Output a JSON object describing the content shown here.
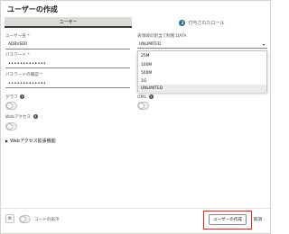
{
  "dialog": {
    "title": "ユーザーの作成"
  },
  "tabs": [
    {
      "label": "ユーザー"
    },
    {
      "label": "付与されたロール",
      "badge": "2"
    }
  ],
  "form": {
    "username": {
      "label": "ユーザー名",
      "required_mark": "*",
      "value": "ADBUSER"
    },
    "password": {
      "label": "パスワード",
      "required_mark": "*",
      "value": "•••••••••••••"
    },
    "password_confirm": {
      "label": "パスワードの確認",
      "required_mark": "*",
      "value": "•••••••••••••"
    },
    "graph": {
      "label": "グラフ",
      "enabled": false
    },
    "web_access": {
      "label": "Webアクセス",
      "enabled": false
    },
    "oml": {
      "label": "OML",
      "enabled": false
    },
    "advanced_web": {
      "label": "Webアクセス拡張機能"
    }
  },
  "quota": {
    "label": "表領域の割当て制限 DATA",
    "selected": "UNLIMITED",
    "options": [
      "25M",
      "100M",
      "500M",
      "1G",
      "UNLIMITED"
    ]
  },
  "footer": {
    "show_code_label": "コードの表示",
    "create_label": "ユーザーの作成",
    "cancel_label": "取消"
  },
  "icons": {
    "help": "?",
    "chevron": "▾",
    "expand": "▶",
    "gear": "⚙"
  },
  "colors": {
    "tab_underline": "#3a3a3a",
    "badge": "#2e6e8e",
    "required": "#b3341c",
    "highlight_border": "#d9241f"
  }
}
